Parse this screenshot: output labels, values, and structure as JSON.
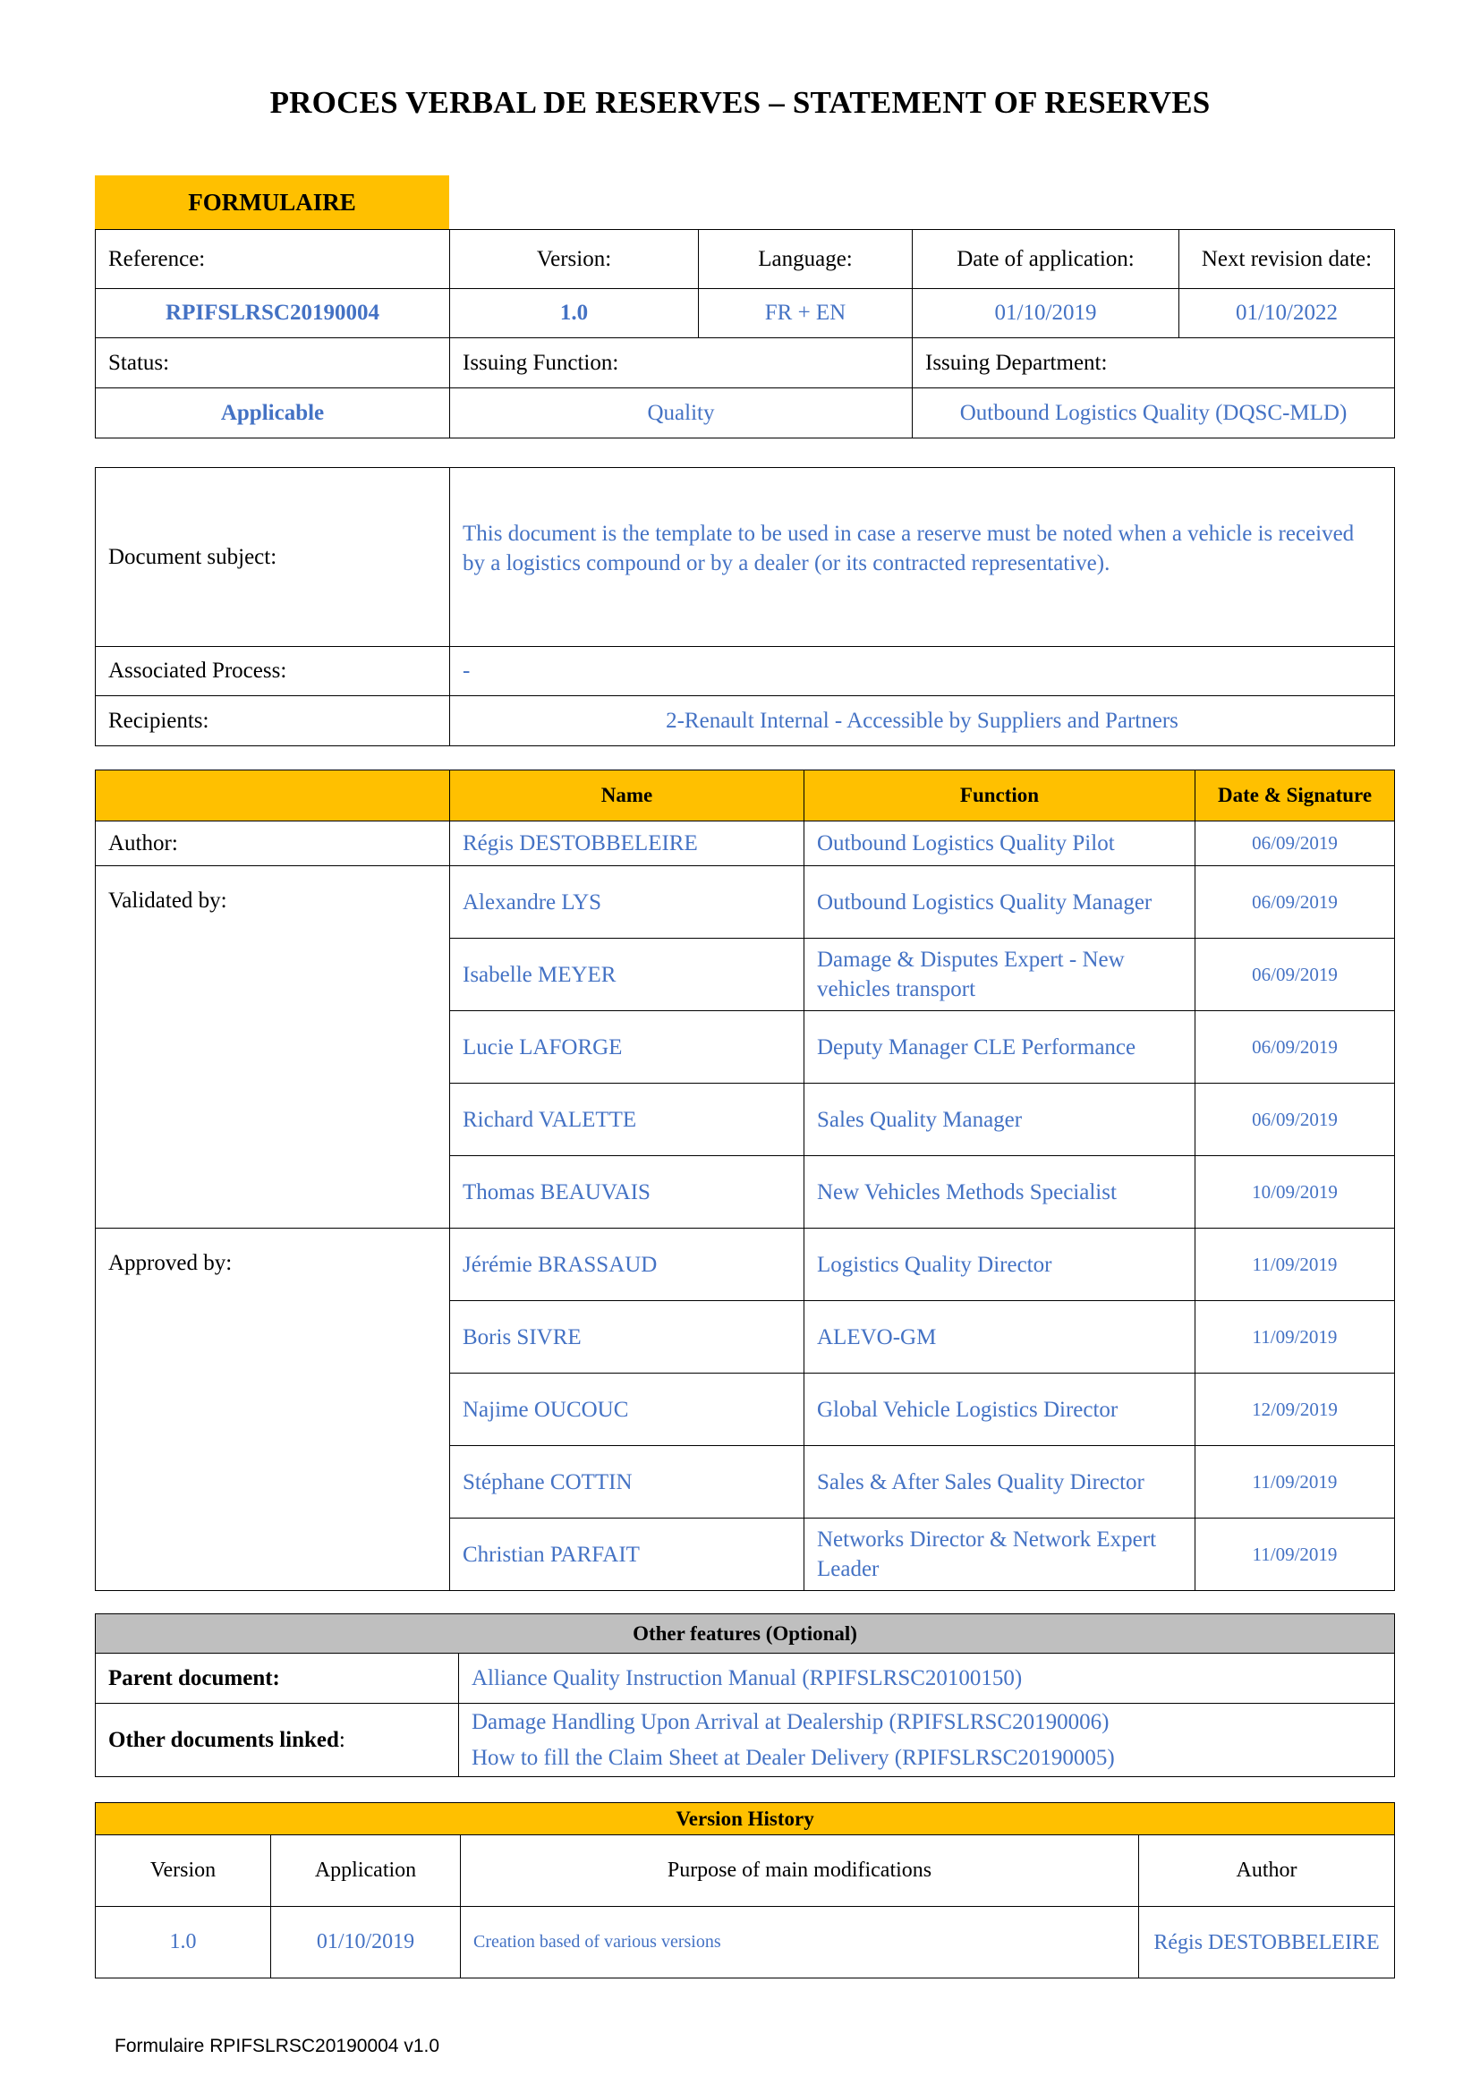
{
  "title": "PROCES VERBAL DE RESERVES – STATEMENT OF RESERVES",
  "form_label": "FORMULAIRE",
  "reference": {
    "labels": {
      "reference": "Reference:",
      "version": "Version:",
      "language": "Language:",
      "date_application": "Date of application:",
      "next_revision": "Next revision date:"
    },
    "values": {
      "reference": "RPIFSLRSC20190004",
      "version": "1.0",
      "language": "FR + EN",
      "date_application": "01/10/2019",
      "next_revision": "01/10/2022"
    },
    "status_label": "Status:",
    "issuing_function_label": "Issuing Function:",
    "issuing_department_label": "Issuing Department:",
    "status": "Applicable",
    "issuing_function": "Quality",
    "issuing_department": "Outbound Logistics Quality (DQSC-MLD)"
  },
  "subject": {
    "subject_label": "Document subject:",
    "subject_text": "This document is the template to be used in case a reserve must be noted when a vehicle is received by a logistics compound or by a dealer (or its contracted representative).",
    "process_label": "Associated Process:",
    "process_value": "-",
    "recipients_label": "Recipients:",
    "recipients_value": "2-Renault Internal - Accessible by Suppliers and Partners"
  },
  "signatures": {
    "headers": {
      "name": "Name",
      "function": "Function",
      "date": "Date & Signature"
    },
    "author_label": "Author:",
    "validated_label": "Validated by:",
    "approved_label": "Approved by:",
    "author": {
      "name": "Régis DESTOBBELEIRE",
      "function": "Outbound Logistics Quality Pilot",
      "date": "06/09/2019"
    },
    "validated": [
      {
        "name": "Alexandre LYS",
        "function": "Outbound Logistics Quality Manager",
        "date": "06/09/2019"
      },
      {
        "name": "Isabelle MEYER",
        "function": "Damage & Disputes Expert - New vehicles transport",
        "date": "06/09/2019"
      },
      {
        "name": "Lucie LAFORGE",
        "function": "Deputy Manager CLE Performance",
        "date": "06/09/2019"
      },
      {
        "name": "Richard VALETTE",
        "function": "Sales Quality Manager",
        "date": "06/09/2019"
      },
      {
        "name": "Thomas BEAUVAIS",
        "function": "New Vehicles Methods Specialist",
        "date": "10/09/2019"
      }
    ],
    "approved": [
      {
        "name": "Jérémie BRASSAUD",
        "function": "Logistics Quality Director",
        "date": "11/09/2019"
      },
      {
        "name": "Boris SIVRE",
        "function": "ALEVO-GM",
        "date": "11/09/2019"
      },
      {
        "name": "Najime OUCOUC",
        "function": "Global Vehicle Logistics Director",
        "date": "12/09/2019"
      },
      {
        "name": "Stéphane COTTIN",
        "function": "Sales & After Sales Quality Director",
        "date": "11/09/2019"
      },
      {
        "name": "Christian PARFAIT",
        "function": "Networks Director & Network Expert Leader",
        "date": "11/09/2019"
      }
    ]
  },
  "features": {
    "header": "Other features (Optional)",
    "parent_label": "Parent document:",
    "parent_value": "Alliance Quality Instruction Manual (RPIFSLRSC20100150)",
    "linked_label": "Other documents linked",
    "linked_colon": ":",
    "linked_values": [
      "Damage Handling Upon Arrival at Dealership (RPIFSLRSC20190006)",
      "How to fill the Claim Sheet at Dealer Delivery (RPIFSLRSC20190005)"
    ]
  },
  "history": {
    "header": "Version History",
    "columns": {
      "version": "Version",
      "application": "Application",
      "purpose": "Purpose of main modifications",
      "author": "Author"
    },
    "rows": [
      {
        "version": "1.0",
        "application": "01/10/2019",
        "purpose": "Creation based of various versions",
        "author": "Régis DESTOBBELEIRE"
      }
    ]
  },
  "footer": "Formulaire RPIFSLRSC20190004 v1.0"
}
